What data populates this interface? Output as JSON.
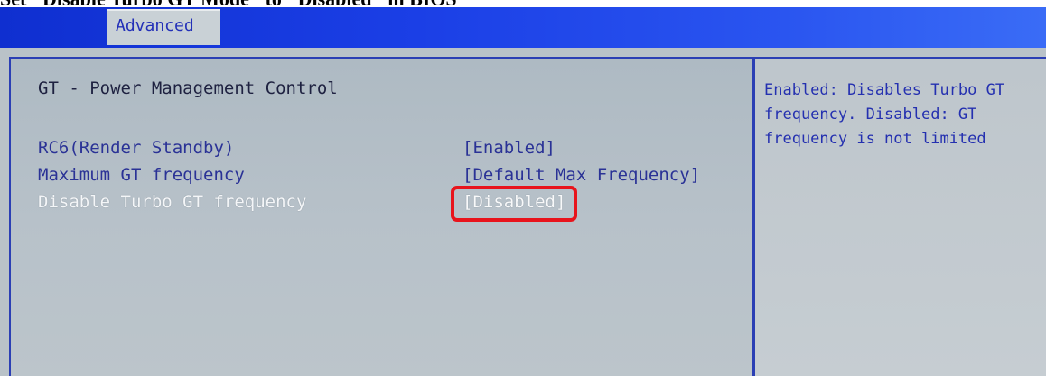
{
  "caption": "Set \"Disable Turbo GT Mode\" to \"Disabled\" in BIOS",
  "tabs": [
    {
      "label": "Advanced",
      "selected": true
    }
  ],
  "main": {
    "section_title": "GT - Power Management Control",
    "settings": [
      {
        "label": "RC6(Render Standby)",
        "value": "[Enabled]"
      },
      {
        "label": "Maximum GT frequency",
        "value": "[Default Max Frequency]"
      },
      {
        "label": "Disable Turbo GT frequency",
        "value": "[Disabled]",
        "selected": true
      }
    ]
  },
  "help": {
    "text": "Enabled: Disables Turbo GT frequency. Disabled: GT frequency is not limited"
  },
  "colors": {
    "tab_bar": "#1b3fe6",
    "panel_bg": "#b7c1c9",
    "text_blue": "#2a3296",
    "highlight_red": "#e8141c"
  }
}
